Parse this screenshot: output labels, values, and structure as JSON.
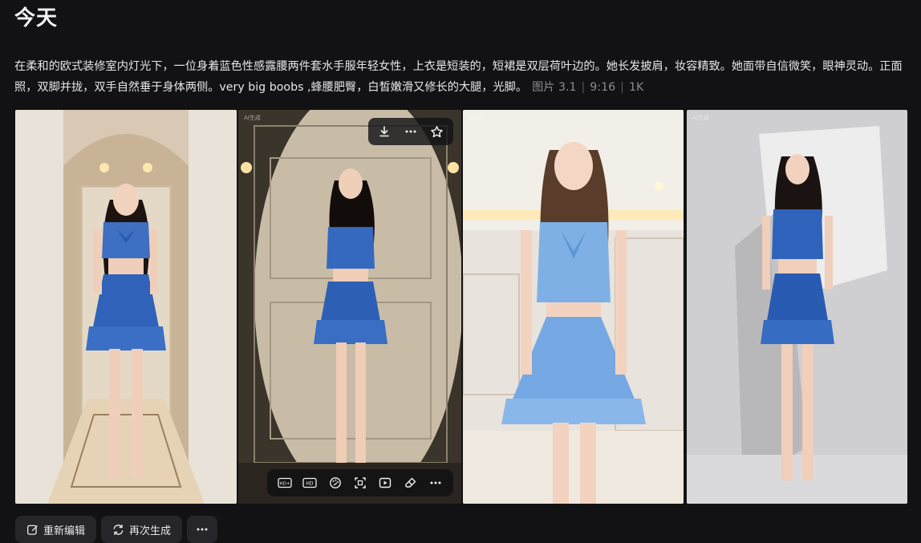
{
  "header": {
    "title": "今天"
  },
  "prompt": {
    "text": "在柔和的欧式装修室内灯光下，一位身着蓝色性感露腰两件套水手服年轻女性，上衣是短装的，短裙是双层荷叶边的。她长发披肩，妆容精致。她面带自信微笑，眼神灵动。正面照，双脚并拢，双手自然垂于身体两侧。very big boobs ,蜂腰肥臀，白皙嫩滑又修长的大腿，光脚。",
    "model": "图片 3.1",
    "ratio": "9:16",
    "resolution": "1K"
  },
  "watermark": "AI生成",
  "hover_toolbar": [
    "download-icon",
    "more-icon",
    "star-icon"
  ],
  "image_toolbar": [
    "hd-plus-icon",
    "hd-icon",
    "palette-icon",
    "expand-icon",
    "video-icon",
    "eraser-icon",
    "more-icon"
  ],
  "actions": {
    "reedit": "重新编辑",
    "regenerate": "再次生成"
  }
}
